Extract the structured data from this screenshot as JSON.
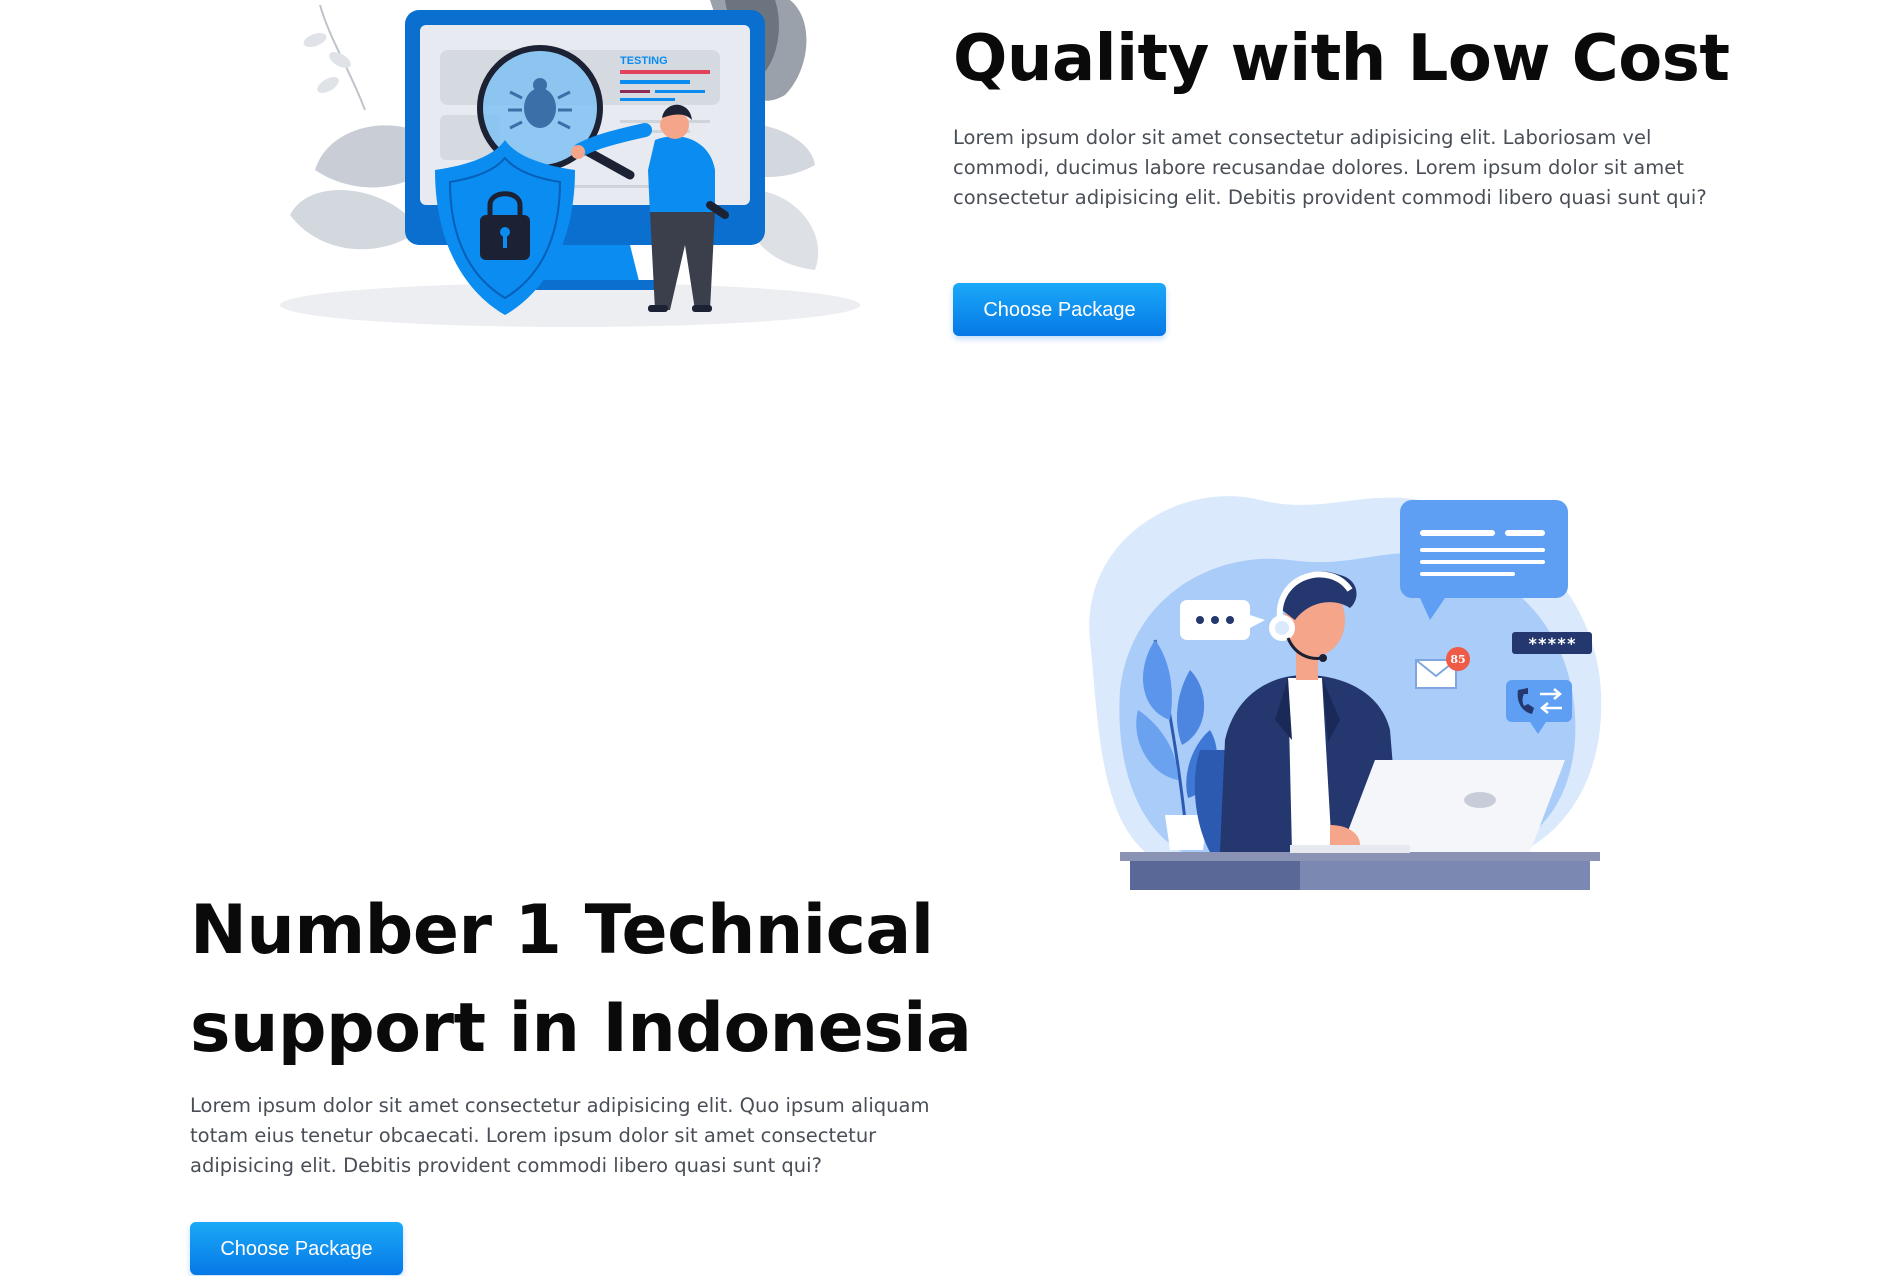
{
  "section_quality": {
    "title": "Quality with Low Cost",
    "text": "Lorem ipsum dolor sit amet consectetur adipisicing elit. Laboriosam vel commodi, ducimus labore recusandae dolores. Lorem ipsum dolor sit amet consectetur adipisicing elit. Debitis provident commodi libero quasi sunt qui?",
    "button_label": "Choose Package",
    "illustration": {
      "icon": "security-testing-illustration",
      "screen_label": "TESTING"
    }
  },
  "section_support": {
    "title": "Number 1 Technical support in Indonesia",
    "text": "Lorem ipsum dolor sit amet consectetur adipisicing elit. Quo ipsum aliquam totam eius tenetur obcaecati. Lorem ipsum dolor sit amet consectetur adipisicing elit. Debitis provident commodi libero quasi sunt qui?",
    "button_label": "Choose Package",
    "illustration": {
      "icon": "customer-support-illustration",
      "notification_count": "85",
      "password_mask": "*****"
    }
  },
  "colors": {
    "accent": "#0a8cf0",
    "heading": "#0a0a0a",
    "body_text": "#4a4f57"
  }
}
